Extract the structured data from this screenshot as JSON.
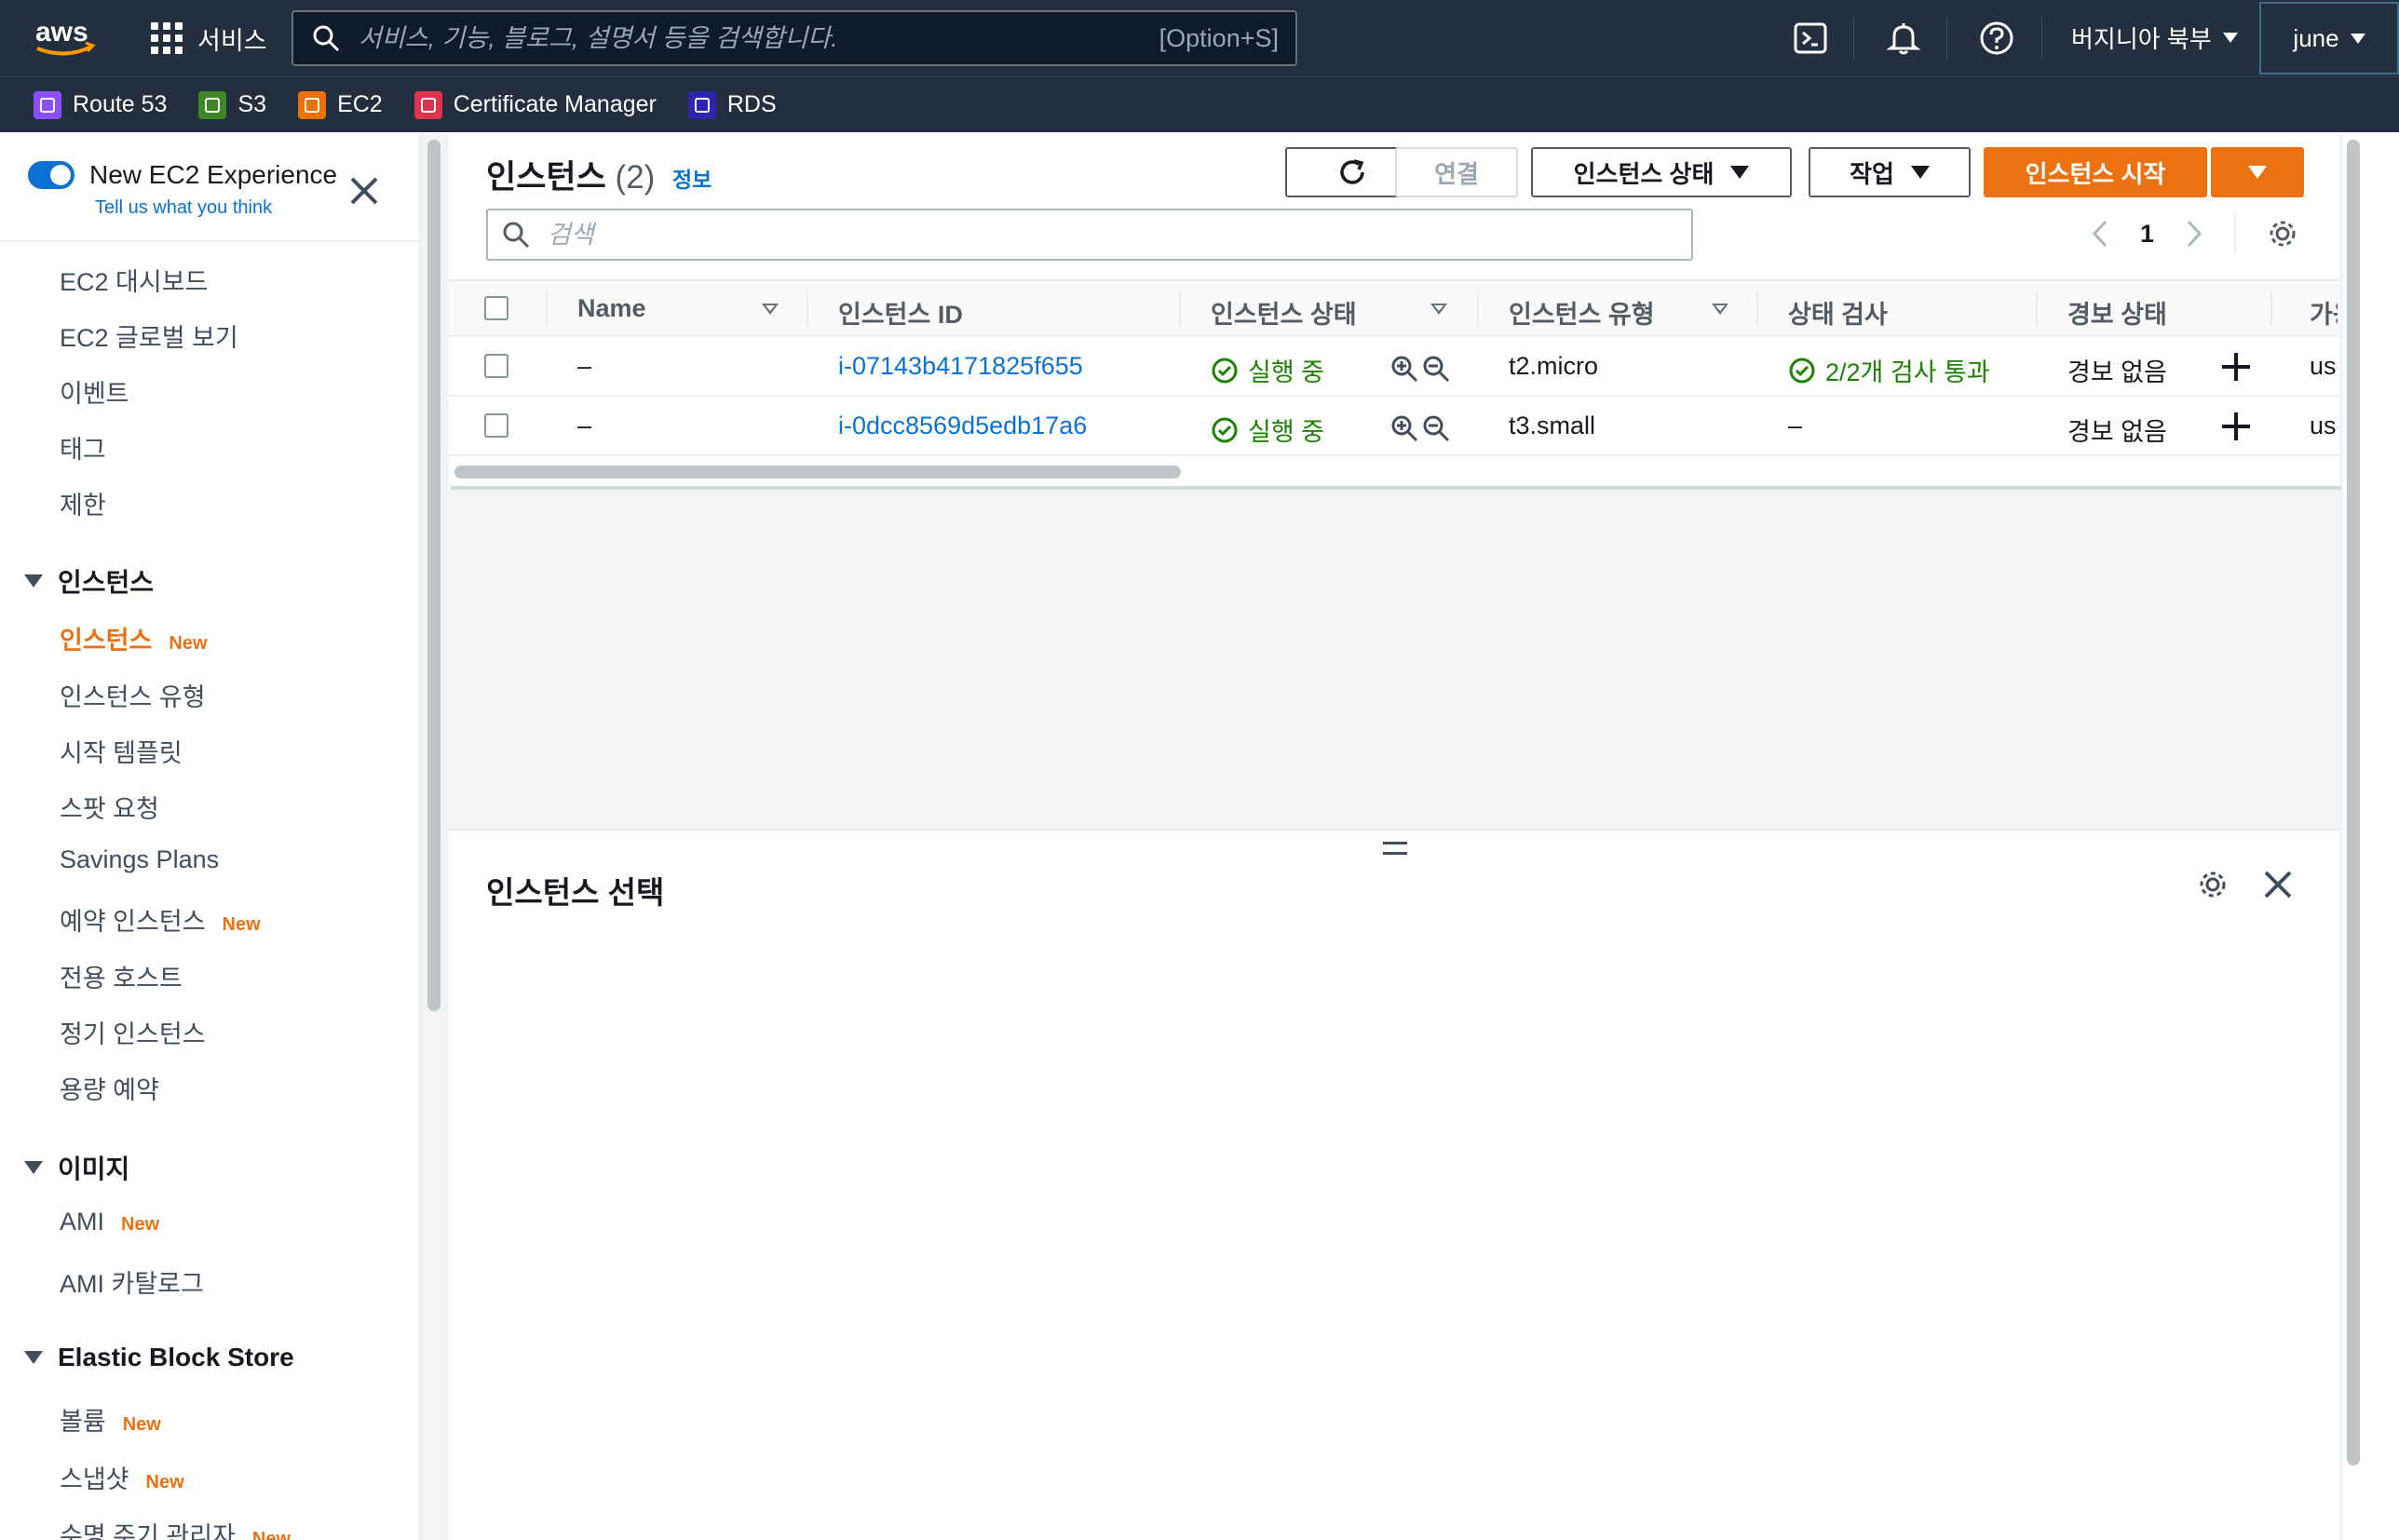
{
  "topnav": {
    "services_label": "서비스",
    "search_placeholder": "서비스, 기능, 블로그, 설명서 등을 검색합니다.",
    "shortcut_hint": "[Option+S]",
    "region": "버지니아 북부",
    "user": "june"
  },
  "favorites": [
    {
      "label": "Route 53",
      "color": "#8c4fff"
    },
    {
      "label": "S3",
      "color": "#3f8624"
    },
    {
      "label": "EC2",
      "color": "#ed7100"
    },
    {
      "label": "Certificate Manager",
      "color": "#dd344c"
    },
    {
      "label": "RDS",
      "color": "#2e27ad"
    }
  ],
  "sidebar": {
    "experience_title": "New EC2 Experience",
    "experience_link": "Tell us what you think",
    "top_items": [
      "EC2 대시보드",
      "EC2 글로벌 보기",
      "이벤트",
      "태그",
      "제한"
    ],
    "sections": [
      {
        "title": "인스턴스",
        "items": [
          {
            "label": "인스턴스",
            "badge": "New",
            "active": true
          },
          {
            "label": "인스턴스 유형",
            "badge": ""
          },
          {
            "label": "시작 템플릿",
            "badge": ""
          },
          {
            "label": "스팟 요청",
            "badge": ""
          },
          {
            "label": "Savings Plans",
            "badge": ""
          },
          {
            "label": "예약 인스턴스",
            "badge": "New"
          },
          {
            "label": "전용 호스트",
            "badge": ""
          },
          {
            "label": "정기 인스턴스",
            "badge": ""
          },
          {
            "label": "용량 예약",
            "badge": ""
          }
        ]
      },
      {
        "title": "이미지",
        "items": [
          {
            "label": "AMI",
            "badge": "New"
          },
          {
            "label": "AMI 카탈로그",
            "badge": ""
          }
        ]
      },
      {
        "title": "Elastic Block Store",
        "items": [
          {
            "label": "볼륨",
            "badge": "New"
          },
          {
            "label": "스냅샷",
            "badge": "New"
          },
          {
            "label": "수명 주기 관리자",
            "badge": "New"
          }
        ]
      }
    ]
  },
  "main": {
    "title": "인스턴스",
    "count": "(2)",
    "info_link": "정보",
    "buttons": {
      "connect": "연결",
      "instance_state": "인스턴스 상태",
      "actions": "작업",
      "launch": "인스턴스 시작"
    },
    "search_placeholder": "검색",
    "page": "1",
    "columns": [
      "Name",
      "인스턴스 ID",
      "인스턴스 상태",
      "인스턴스 유형",
      "상태 검사",
      "경보 상태",
      "가용"
    ],
    "rows": [
      {
        "name": "–",
        "id": "i-07143b4171825f655",
        "state": "실행 중",
        "type": "t2.micro",
        "check": "2/2개 검사 통과",
        "alarm": "경보 없음",
        "az": "us-"
      },
      {
        "name": "–",
        "id": "i-0dcc8569d5edb17a6",
        "state": "실행 중",
        "type": "t3.small",
        "check": "–",
        "alarm": "경보 없음",
        "az": "us-"
      }
    ],
    "detail_title": "인스턴스 선택"
  }
}
